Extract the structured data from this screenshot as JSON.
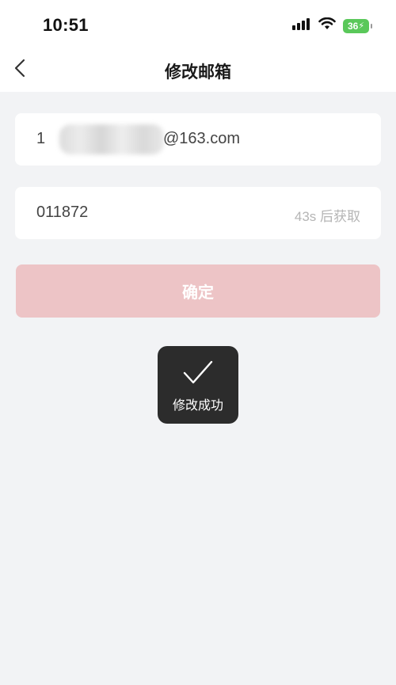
{
  "status_bar": {
    "time": "10:51",
    "battery_level": "36",
    "icons": [
      "cellular-signal-icon",
      "wifi-icon",
      "battery-charging-icon"
    ]
  },
  "nav": {
    "title": "修改邮箱",
    "back_icon": "chevron-left-icon"
  },
  "form": {
    "email": {
      "prefix": "1",
      "suffix": "@163.com"
    },
    "code": {
      "value": "011872",
      "countdown": "43s 后获取"
    },
    "confirm_label": "确定"
  },
  "toast": {
    "icon": "checkmark-icon",
    "message": "修改成功"
  },
  "colors": {
    "background": "#f2f3f5",
    "button_disabled": "#edc4c6",
    "toast_bg": "#2c2c2c",
    "battery": "#5ac85a"
  }
}
